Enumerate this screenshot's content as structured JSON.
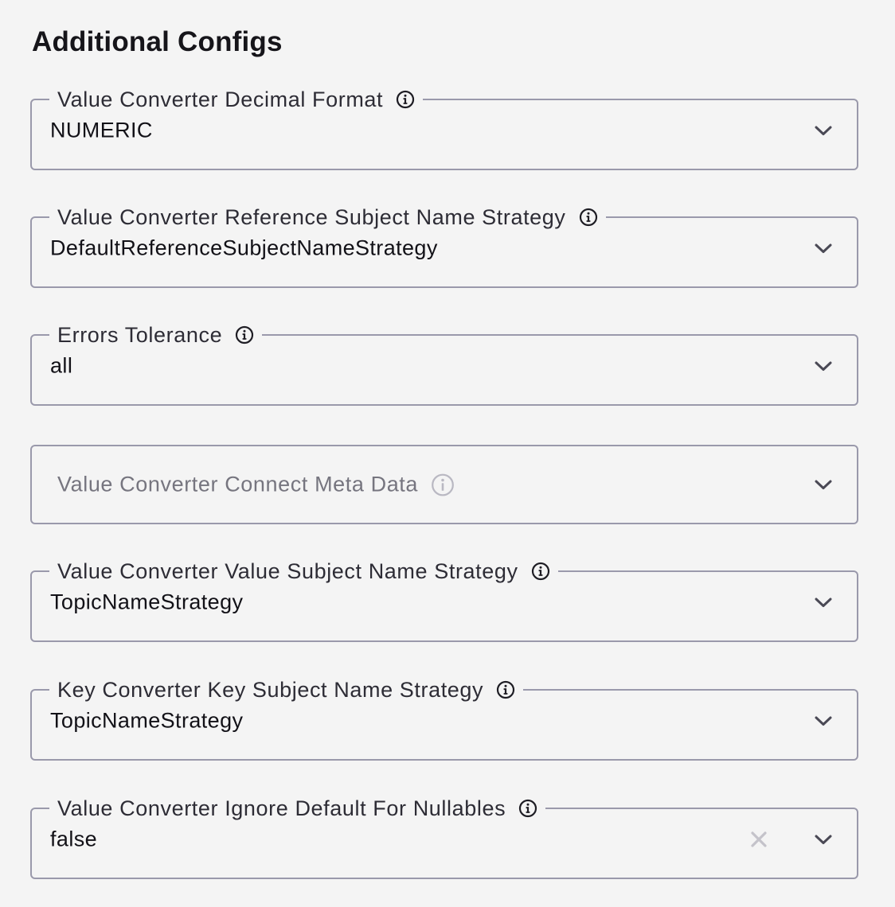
{
  "section": {
    "title": "Additional Configs"
  },
  "fields": [
    {
      "label": "Value Converter Decimal Format",
      "value": "NUMERIC",
      "icon": "info-icon",
      "chevron_icon": "chevron-down-icon"
    },
    {
      "label": "Value Converter Reference Subject Name Strategy",
      "value": "DefaultReferenceSubjectNameStrategy",
      "icon": "info-icon",
      "chevron_icon": "chevron-down-icon"
    },
    {
      "label": "Errors Tolerance",
      "value": "all",
      "icon": "info-icon",
      "chevron_icon": "chevron-down-icon"
    },
    {
      "label": "Value Converter Connect Meta Data",
      "value": "",
      "icon": "info-icon",
      "chevron_icon": "chevron-down-icon"
    },
    {
      "label": "Value Converter Value Subject Name Strategy",
      "value": "TopicNameStrategy",
      "icon": "info-icon",
      "chevron_icon": "chevron-down-icon"
    },
    {
      "label": "Key Converter Key Subject Name Strategy",
      "value": "TopicNameStrategy",
      "icon": "info-icon",
      "chevron_icon": "chevron-down-icon"
    },
    {
      "label": "Value Converter Ignore Default For Nullables",
      "value": "false",
      "icon": "info-icon",
      "clear_icon": "clear-icon",
      "chevron_icon": "chevron-down-icon"
    }
  ],
  "colors": {
    "background": "#f4f4f4",
    "border": "#9a99ab",
    "text": "#121117",
    "label": "#2d2c35",
    "placeholder": "#76757f"
  }
}
